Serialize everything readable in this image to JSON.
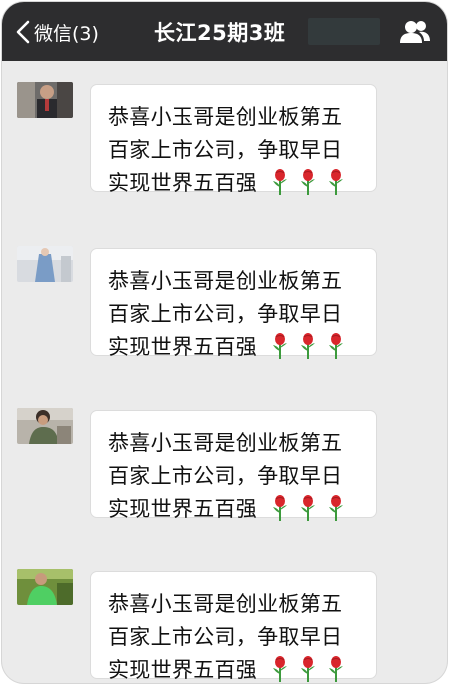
{
  "navbar": {
    "back_label": "微信(3)",
    "title": "长江25期3班"
  },
  "messages": [
    {
      "text": "恭喜小玉哥是创业板第五百家上市公司，争取早日实现世界五百强"
    },
    {
      "text": "恭喜小玉哥是创业板第五百家上市公司，争取早日实现世界五百强"
    },
    {
      "text": "恭喜小玉哥是创业板第五百家上市公司，争取早日实现世界五百强"
    },
    {
      "text": "恭喜小玉哥是创业板第五百家上市公司，争取早日实现世界五百强"
    }
  ],
  "colors": {
    "navbar_bg": "#2d2d2f",
    "chat_bg": "#ebebeb",
    "bubble_bg": "#ffffff",
    "rose_red": "#d9262c",
    "rose_green": "#3c9a3c"
  },
  "icons": {
    "back": "chevron-left-icon",
    "group": "group-members-icon",
    "emoji": "rose-emoji"
  }
}
